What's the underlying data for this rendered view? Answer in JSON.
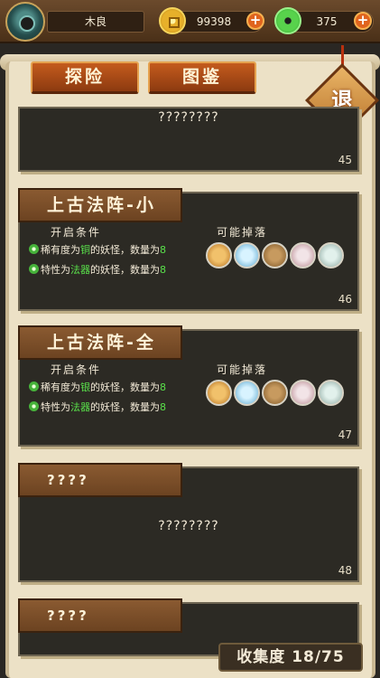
{
  "player": {
    "name": "木良"
  },
  "resources": {
    "gold": "99398",
    "jade": "375"
  },
  "tabs": {
    "explore": "探险",
    "guide": "图鉴"
  },
  "exit_label": "退",
  "cards": [
    {
      "title": "",
      "unknown_text": "????????",
      "number": "45"
    },
    {
      "title": "上古法阵-小",
      "conditions_label": "开启条件",
      "drops_label": "可能掉落",
      "conditions": [
        {
          "pre": "稀有度为",
          "hl": "铜",
          "post": "的妖怪，数量为",
          "count": "8"
        },
        {
          "pre": "特性为",
          "hl": "法器",
          "post": "的妖怪，数量为",
          "count": "8"
        }
      ],
      "drops": [
        "coin-item-icon",
        "crystal-item-icon",
        "pouch-item-icon",
        "scroll-item-icon",
        "mirror-item-icon"
      ],
      "number": "46"
    },
    {
      "title": "上古法阵-全",
      "conditions_label": "开启条件",
      "drops_label": "可能掉落",
      "conditions": [
        {
          "pre": "稀有度为",
          "hl": "银",
          "post": "的妖怪，数量为",
          "count": "8"
        },
        {
          "pre": "特性为",
          "hl": "法器",
          "post": "的妖怪，数量为",
          "count": "8"
        }
      ],
      "drops": [
        "coin-item-icon",
        "crystal-item-icon",
        "pouch-item-icon",
        "scroll-item-icon",
        "mirror-item-icon"
      ],
      "number": "47"
    },
    {
      "title": "????",
      "unknown_text": "????????",
      "number": "48"
    },
    {
      "title": "????"
    }
  ],
  "collection": {
    "label": "收集度",
    "value": "18/75"
  }
}
